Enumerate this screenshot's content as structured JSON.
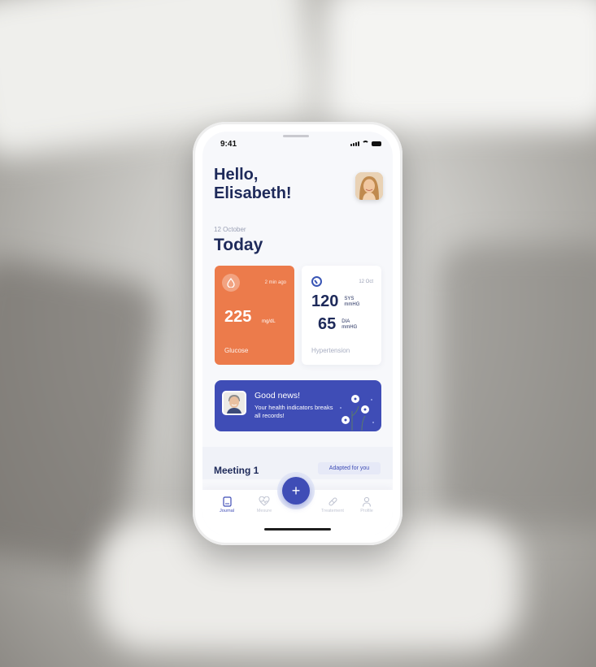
{
  "status": {
    "time": "9:41"
  },
  "header": {
    "greeting": "Hello,\nElisabeth!"
  },
  "date": "12 October",
  "section_title": "Today",
  "glucose": {
    "time_ago": "2 min ago",
    "value": "225",
    "unit": "mg/dL",
    "label": "Glucose",
    "color": "#ec7b4b"
  },
  "hypertension": {
    "date": "12 Oct",
    "sys_value": "120",
    "sys_label": "SYS",
    "sys_unit": "mmHG",
    "dia_value": "65",
    "dia_label": "DIA",
    "dia_unit": "mmHG",
    "label": "Hypertension"
  },
  "news": {
    "title": "Good news!",
    "text": "Your health indicators breaks all records!",
    "color": "#3f4db6"
  },
  "meeting": {
    "title": "Meeting 1",
    "badge": "Adapted for you"
  },
  "tabs": [
    {
      "label": "Journal",
      "icon": "book-icon",
      "active": true
    },
    {
      "label": "Mesure",
      "icon": "heart-icon",
      "active": false
    },
    {
      "label": "Treatement",
      "icon": "pill-icon",
      "active": false
    },
    {
      "label": "Profile",
      "icon": "user-icon",
      "active": false
    }
  ],
  "fab": {
    "label": "+"
  }
}
